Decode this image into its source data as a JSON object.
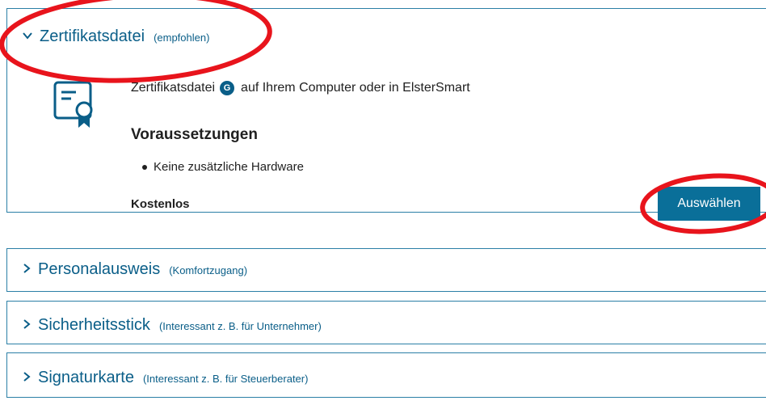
{
  "top_text": "",
  "accordion": [
    {
      "label": "Zertifikatsdatei",
      "sub": "(empfohlen)",
      "expanded": true
    },
    {
      "label": "Personalausweis",
      "sub": "(Komfortzugang)",
      "expanded": false
    },
    {
      "label": "Sicherheitsstick",
      "sub": "(Interessant z. B. für Unternehmer)",
      "expanded": false
    },
    {
      "label": "Signaturkarte",
      "sub": "(Interessant z. B. für Steuerberater)",
      "expanded": false
    }
  ],
  "open_panel": {
    "icon": "certificate-icon",
    "description_prefix": "Zertifikatsdatei",
    "glossary_badge": "G",
    "description_suffix": "auf Ihrem Computer oder in ElsterSmart",
    "requirements_title": "Voraussetzungen",
    "requirements": [
      "Keine zusätzliche Hardware"
    ],
    "price": "Kostenlos",
    "button_label": "Auswählen"
  },
  "colors": {
    "accent": "#0a5e88",
    "button": "#0a6f99",
    "border": "#2b7fa6",
    "annotation": "#e8141c"
  }
}
